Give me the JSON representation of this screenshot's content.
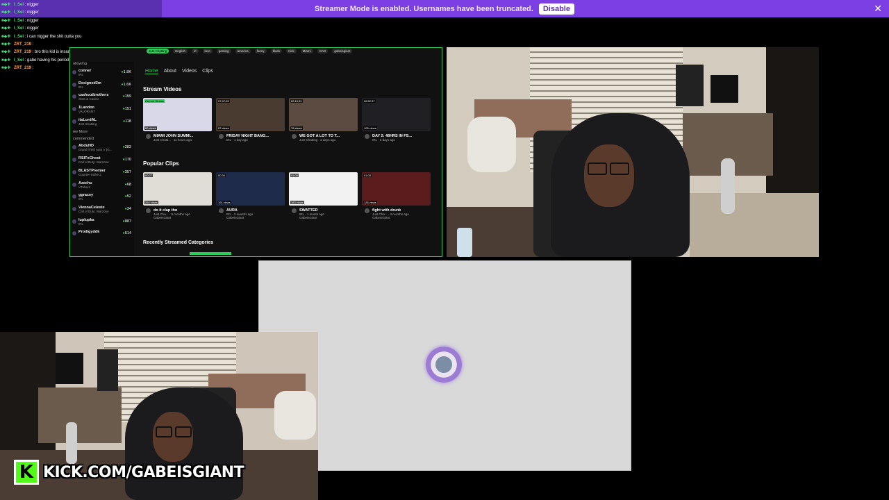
{
  "banner": {
    "text": "Streamer Mode is enabled. Usernames have been truncated.",
    "button": "Disable",
    "close_icon": "close-icon"
  },
  "chat": [
    {
      "user": "I_Sel",
      "msg": "nigger"
    },
    {
      "user": "I_Sel",
      "msg": "nigger"
    },
    {
      "user": "I_Sel",
      "msg": "nigger"
    },
    {
      "user": "I_Sel",
      "msg": "nigger"
    },
    {
      "user": "I_Sel",
      "msg": "i can nigger the shit outta you"
    },
    {
      "user": "ZRT_219",
      "msg": ""
    },
    {
      "user": "ZRT_219",
      "msg": "bro this kid is insane"
    },
    {
      "user": "I_Sel",
      "msg": "gabe having his period"
    },
    {
      "user": "ZRT_219",
      "msg": ""
    }
  ],
  "browser": {
    "tags": [
      "Just Chatting",
      "English",
      "irl",
      "love",
      "gaming",
      "america",
      "funny",
      "black",
      "Kick",
      "Miami",
      "GAD",
      "gabeisgiant"
    ],
    "following_label": "ollowing",
    "following": [
      {
        "name": "conner",
        "sub": "IRL",
        "count": "1.8K"
      },
      {
        "name": "Designed3m",
        "sub": "IRL",
        "count": "1.6K"
      },
      {
        "name": "cashoutbrothers",
        "sub": "Slots & Casino",
        "count": "159"
      },
      {
        "name": "1Landon",
        "sub": "VALORANT",
        "count": "151"
      },
      {
        "name": "itsLordAL",
        "sub": "Just Chatting",
        "count": "118"
      }
    ],
    "show_more": "ow More",
    "recommended_label": "commended",
    "recommended": [
      {
        "name": "AbduHD",
        "sub": "Grand Theft Auto V (G...",
        "count": "283"
      },
      {
        "name": "RSITxGhost",
        "sub": "Call of Duty: Warzone",
        "count": "170"
      },
      {
        "name": "BLASTPremier",
        "sub": "Counter-Strike 2",
        "count": "357"
      },
      {
        "name": "Azechu",
        "sub": "VTubers",
        "count": "68"
      },
      {
        "name": "ggracey",
        "sub": "IRL",
        "count": "52"
      },
      {
        "name": "ViennaCeleste",
        "sub": "Call of Duty: Warzone",
        "count": "34"
      },
      {
        "name": "luplupka",
        "sub": "IRL",
        "count": "887"
      },
      {
        "name": "Prodigyddk",
        "sub": "",
        "count": "514"
      }
    ],
    "nav": [
      "Home",
      "About",
      "Videos",
      "Clips"
    ],
    "stream_videos_title": "Stream Videos",
    "stream_videos": [
      {
        "time": "Current Stream",
        "views": "60 views",
        "title": "MIAMI JOHN SUMMI...",
        "meta": "Just Chatti... · 11 hours ago"
      },
      {
        "time": "07:47:03",
        "views": "67 views",
        "title": "FRIDAY NIGHT BANG...",
        "meta": "IRL · 1 day ago"
      },
      {
        "time": "02:10:31",
        "views": "78 views",
        "title": "WE GOT A LOT TO T...",
        "meta": "Just Chatting · 3 days ago"
      },
      {
        "time": "06:52:37",
        "views": "105 views",
        "title": "DAY 2: 48HRS IN FS...",
        "meta": "IRL · 6 days ago"
      }
    ],
    "popular_clips_title": "Popular Clips",
    "popular_clips": [
      {
        "time": "00:27",
        "views": "354 views",
        "title": "do it clap tho",
        "meta": "Just Cha... · 9 months ago",
        "author": "GabeIsGiant"
      },
      {
        "time": "00:30",
        "views": "191 views",
        "title": "AURA",
        "meta": "IRL · 2 months ago",
        "author": "GabeIsGiant"
      },
      {
        "time": "01:00",
        "views": "163 views",
        "title": "SWATTED",
        "meta": "IRL · 1 month ago",
        "author": "GabeIsGiant"
      },
      {
        "time": "01:00",
        "views": "126 views",
        "title": "fight with drunk",
        "meta": "Just Cha... · 3 months ago",
        "author": "GabeIsGiant"
      }
    ],
    "recent_title": "Recently Streamed Categories"
  },
  "overlay": {
    "kick_logo": "K",
    "kick_url": "KICK.COM/GABEISGIANT"
  }
}
